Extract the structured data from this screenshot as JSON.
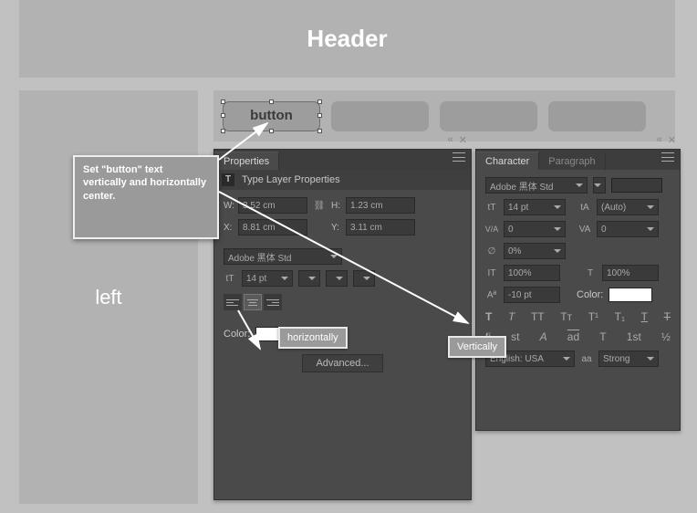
{
  "header": {
    "title": "Header"
  },
  "left_panel": {
    "label": "left"
  },
  "nav": {
    "selected_label": "button"
  },
  "callout": {
    "text": "Set \"button\" text vertically and horizontally center."
  },
  "tips": {
    "horizontal": "horizontally",
    "vertical": "Vertically"
  },
  "properties": {
    "tab": "Properties",
    "section": "Type Layer Properties",
    "w_label": "W:",
    "w_value": "3.52 cm",
    "h_label": "H:",
    "h_value": "1.23 cm",
    "x_label": "X:",
    "x_value": "8.81 cm",
    "y_label": "Y:",
    "y_value": "3.11 cm",
    "font_family": "Adobe 黑体 Std",
    "font_size": "14 pt",
    "color_label": "Color:",
    "advanced": "Advanced..."
  },
  "character": {
    "tab1": "Character",
    "tab2": "Paragraph",
    "font_family": "Adobe 黑体 Std",
    "size": "14 pt",
    "leading": "(Auto)",
    "va": "0",
    "kerning": "0",
    "tracking": "0%",
    "hscale": "100%",
    "vscale": "100%",
    "baseline": "-10 pt",
    "color_label": "Color:",
    "lang": "English: USA",
    "aa_label": "aa",
    "aa_mode": "Strong",
    "icons_typo": [
      "fi",
      "st",
      "A",
      "ad",
      "T",
      "1st",
      "½"
    ],
    "icons_style_t": "T"
  }
}
